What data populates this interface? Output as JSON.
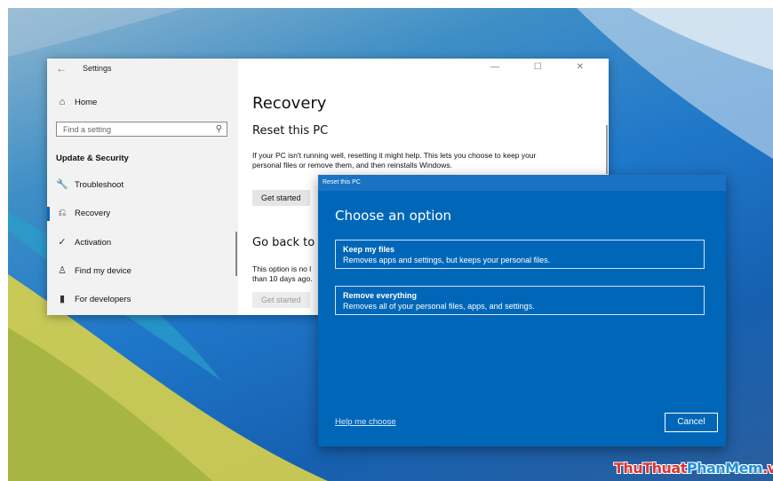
{
  "settings_window": {
    "title": "Settings",
    "back_glyph": "←",
    "window_controls": "— ☐ ✕",
    "nav": {
      "home": {
        "label": "Home",
        "icon": "home-icon",
        "glyph": "⌂"
      },
      "search_placeholder": "Find a setting",
      "search_glyph": "⚲",
      "section_heading": "Update & Security",
      "items": [
        {
          "label": "Troubleshoot",
          "icon": "wrench-icon",
          "glyph": "🔧"
        },
        {
          "label": "Recovery",
          "icon": "recovery-icon",
          "glyph": "⎌",
          "active": true
        },
        {
          "label": "Activation",
          "icon": "check-circle-icon",
          "glyph": "✓"
        },
        {
          "label": "Find my device",
          "icon": "person-pin-icon",
          "glyph": "♙"
        },
        {
          "label": "For developers",
          "icon": "developer-icon",
          "glyph": "▮"
        }
      ]
    },
    "content": {
      "page_title": "Recovery",
      "reset_heading": "Reset this PC",
      "reset_text": "If your PC isn't running well, resetting it might help. This lets you choose to keep your personal files or remove them, and then reinstalls Windows.",
      "get_started_label": "Get started",
      "go_back_heading": "Go back to t",
      "go_back_text_line1": "This option is no l",
      "go_back_text_line2": "than 10 days ago.",
      "get_started_disabled_label": "Get started"
    }
  },
  "reset_dialog": {
    "title": "Reset this PC",
    "heading": "Choose an option",
    "options": [
      {
        "title": "Keep my files",
        "description": "Removes apps and settings, but keeps your personal files."
      },
      {
        "title": "Remove everything",
        "description": "Removes all of your personal files, apps, and settings."
      }
    ],
    "help_link": "Help me choose",
    "cancel_label": "Cancel"
  },
  "watermark": {
    "part1": "ThuThuat",
    "part2": "PhanMem",
    "part3": ".vn"
  },
  "colors": {
    "dialog_bg": "#0067b8",
    "accent": "#0067c0"
  }
}
